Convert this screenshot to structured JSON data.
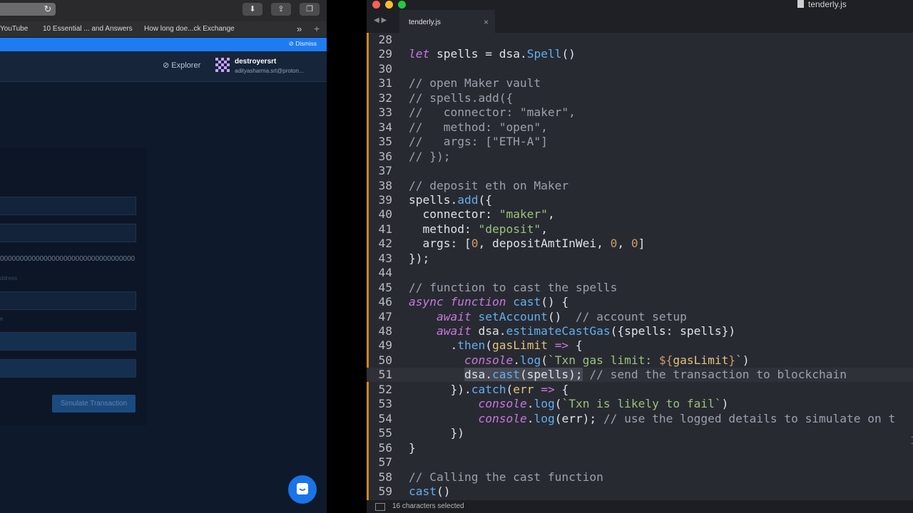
{
  "browser": {
    "bookmarks": [
      "YouTube",
      "10 Essential ... and Answers",
      "How long doe...ck Exchange"
    ],
    "more_glyph": "»",
    "add_glyph": "+",
    "banner_dismiss": "Dismiss",
    "explorer_label": "Explorer",
    "user": {
      "name": "destroyersrt",
      "email": "adityasharma.srt@proton..."
    },
    "address_value": "0000000000000000000000000000000000",
    "field_labels": [
      "ddress",
      "e"
    ],
    "simulate_button": "Simulate Transaction",
    "colors": {
      "banner": "#1e7cf2",
      "background": "#0e1a2b",
      "chat": "#1a73e8"
    }
  },
  "editor": {
    "window_title": "tenderly.js",
    "tab_label": "tenderly.js",
    "tab_close": "×",
    "status": "16 characters selected",
    "current_line": 51,
    "line_numbers": [
      "28",
      "29",
      "30",
      "31",
      "32",
      "33",
      "34",
      "35",
      "36",
      "37",
      "38",
      "39",
      "40",
      "41",
      "42",
      "43",
      "44",
      "45",
      "46",
      "47",
      "48",
      "49",
      "50",
      "51",
      "52",
      "53",
      "54",
      "55",
      "56",
      "57",
      "58",
      "59"
    ],
    "code_lines": [
      "",
      "let spells = dsa.Spell()",
      "",
      "// open Maker vault",
      "// spells.add({",
      "//   connector: \"maker\",",
      "//   method: \"open\",",
      "//   args: [\"ETH-A\"]",
      "// });",
      "",
      "// deposit eth on Maker",
      "spells.add({",
      "  connector: \"maker\",",
      "  method: \"deposit\",",
      "  args: [0, depositAmtInWei, 0, 0]",
      "});",
      "",
      "// function to cast the spells",
      "async function cast() {",
      "    await setAccount()  // account setup",
      "    await dsa.estimateCastGas({spells: spells})",
      "      .then(gasLimit => {",
      "        console.log(`Txn gas limit: ${gasLimit}`)",
      "        dsa.cast(spells); // send the transaction to blockchain",
      "      }).catch(err => {",
      "          console.log(`Txn is likely to fail`)",
      "          console.log(err); // use the logged details to simulate on t",
      "      })",
      "}",
      "",
      "// Calling the cast function",
      "cast()"
    ]
  }
}
